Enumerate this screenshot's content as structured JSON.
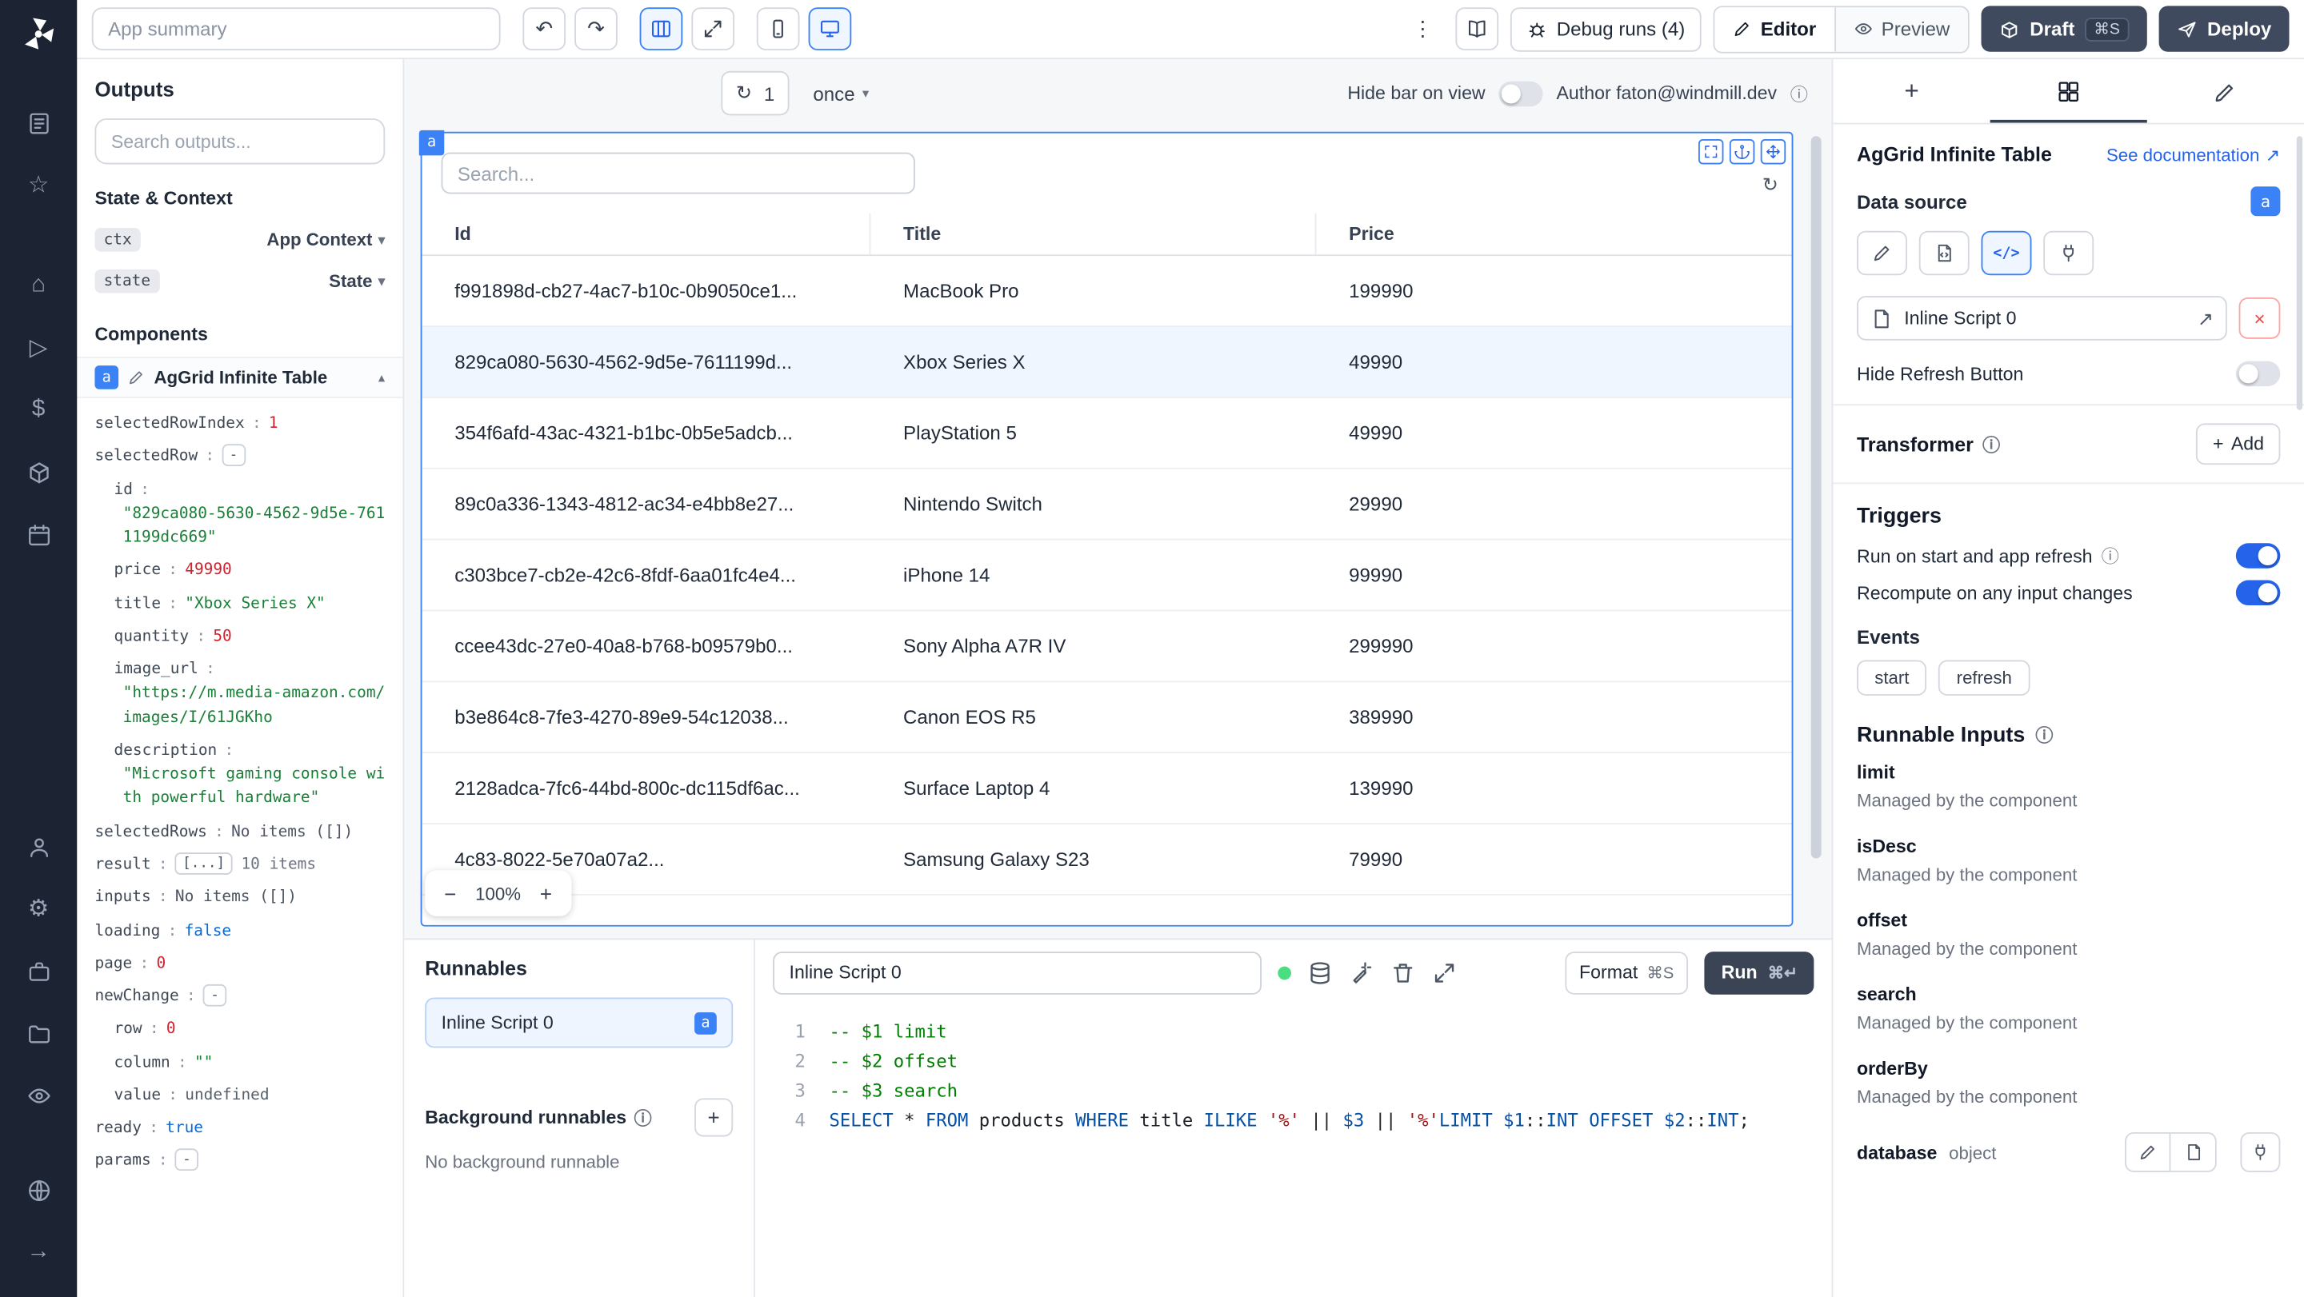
{
  "icons": {
    "undo": "↶",
    "redo": "↷",
    "dots_vertical": "⋮",
    "refresh": "↻",
    "minus": "−",
    "plus": "+",
    "close": "×",
    "external_link": "↗",
    "chevron_down": "▾",
    "chevron_up": "▴",
    "star": "☆",
    "home": "⌂",
    "play": "▷",
    "dollar": "$",
    "gear": "⚙",
    "arrow_right": "→",
    "info": "ⓘ",
    "code": "</>"
  },
  "topbar": {
    "app_summary_placeholder": "App summary",
    "debug_runs_label": "Debug runs (4)",
    "editor_label": "Editor",
    "preview_label": "Preview",
    "draft_label": "Draft",
    "draft_shortcut": "⌘S",
    "deploy_label": "Deploy"
  },
  "outputs": {
    "title": "Outputs",
    "search_placeholder": "Search outputs...",
    "state_context_title": "State & Context",
    "ctx_badge": "ctx",
    "ctx_label": "App Context",
    "state_badge": "state",
    "state_label": "State",
    "components_title": "Components",
    "component_badge": "a",
    "component_title": "AgGrid Infinite Table",
    "tree": [
      {
        "key": "selectedRowIndex",
        "value": "1"
      },
      {
        "key": "selectedRow",
        "value": "-"
      },
      {
        "key": "id",
        "value": "\"829ca080-5630-4562-9d5e-7611199dc669\""
      },
      {
        "key": "price",
        "value": "49990"
      },
      {
        "key": "title",
        "value": "\"Xbox Series X\""
      },
      {
        "key": "quantity",
        "value": "50"
      },
      {
        "key": "image_url",
        "value": "\"https://m.media-amazon.com/images/I/61JGKho"
      },
      {
        "key": "description",
        "value": "\"Microsoft gaming console with powerful hardware\""
      },
      {
        "key": "selectedRows",
        "value": "No items ([])"
      },
      {
        "key": "result",
        "value": "[...]",
        "suffix": "10 items"
      },
      {
        "key": "inputs",
        "value": "No items ([])"
      },
      {
        "key": "loading",
        "value": "false"
      },
      {
        "key": "page",
        "value": "0"
      },
      {
        "key": "newChange",
        "value": "-"
      },
      {
        "key": "row",
        "value": "0"
      },
      {
        "key": "column",
        "value": "\"\""
      },
      {
        "key": "value",
        "value": "undefined"
      },
      {
        "key": "ready",
        "value": "true"
      },
      {
        "key": "params",
        "value": "-"
      }
    ]
  },
  "canvas": {
    "refresh_count": "1",
    "interval_label": "once",
    "hide_bar_label": "Hide bar on view",
    "author_label": "Author faton@windmill.dev",
    "component_badge": "a",
    "search_placeholder": "Search...",
    "zoom_value": "100%",
    "table": {
      "columns": [
        "Id",
        "Title",
        "Price"
      ],
      "rows": [
        {
          "id": "f991898d-cb27-4ac7-b10c-0b9050ce1...",
          "title": "MacBook Pro",
          "price": "199990"
        },
        {
          "id": "829ca080-5630-4562-9d5e-7611199d...",
          "title": "Xbox Series X",
          "price": "49990"
        },
        {
          "id": "354f6afd-43ac-4321-b1bc-0b5e5adcb...",
          "title": "PlayStation 5",
          "price": "49990"
        },
        {
          "id": "89c0a336-1343-4812-ac34-e4bb8e27...",
          "title": "Nintendo Switch",
          "price": "29990"
        },
        {
          "id": "c303bce7-cb2e-42c6-8fdf-6aa01fc4e4...",
          "title": "iPhone 14",
          "price": "99990"
        },
        {
          "id": "ccee43dc-27e0-40a8-b768-b09579b0...",
          "title": "Sony Alpha A7R IV",
          "price": "299990"
        },
        {
          "id": "b3e864c8-7fe3-4270-89e9-54c12038...",
          "title": "Canon EOS R5",
          "price": "389990"
        },
        {
          "id": "2128adca-7fc6-44bd-800c-dc115df6ac...",
          "title": "Surface Laptop 4",
          "price": "139990"
        },
        {
          "id": "4c83-8022-5e70a07a2...",
          "title": "Samsung Galaxy S23",
          "price": "79990"
        }
      ]
    }
  },
  "runnables": {
    "title": "Runnables",
    "item_label": "Inline Script 0",
    "item_badge": "a",
    "background_title": "Background runnables",
    "background_empty": "No background runnable"
  },
  "script_editor": {
    "name_value": "Inline Script 0",
    "format_label": "Format",
    "format_shortcut": "⌘S",
    "run_label": "Run",
    "run_shortcut": "⌘↵",
    "lines": [
      {
        "num": "1",
        "tokens": [
          {
            "c": "comment",
            "t": "-- $1 limit"
          }
        ]
      },
      {
        "num": "2",
        "tokens": [
          {
            "c": "comment",
            "t": "-- $2 offset"
          }
        ]
      },
      {
        "num": "3",
        "tokens": [
          {
            "c": "comment",
            "t": "-- $3 search"
          }
        ]
      },
      {
        "num": "4",
        "tokens": [
          {
            "c": "kw",
            "t": "SELECT"
          },
          {
            "c": "pl",
            "t": " * "
          },
          {
            "c": "kw",
            "t": "FROM"
          },
          {
            "c": "pl",
            "t": " products "
          },
          {
            "c": "kw",
            "t": "WHERE"
          },
          {
            "c": "pl",
            "t": " title "
          },
          {
            "c": "kw",
            "t": "ILIKE"
          },
          {
            "c": "pl",
            "t": " "
          },
          {
            "c": "str",
            "t": "'%'"
          },
          {
            "c": "pl",
            "t": " || "
          },
          {
            "c": "var",
            "t": "$3"
          },
          {
            "c": "pl",
            "t": " || "
          },
          {
            "c": "str",
            "t": "'%'"
          },
          {
            "c": "kw",
            "t": "LIMIT"
          },
          {
            "c": "pl",
            "t": " "
          },
          {
            "c": "var",
            "t": "$1"
          },
          {
            "c": "pl",
            "t": "::"
          },
          {
            "c": "kw",
            "t": "INT"
          },
          {
            "c": "pl",
            "t": " "
          },
          {
            "c": "kw",
            "t": "OFFSET"
          },
          {
            "c": "pl",
            "t": " "
          },
          {
            "c": "var",
            "t": "$2"
          },
          {
            "c": "pl",
            "t": "::"
          },
          {
            "c": "kw",
            "t": "INT"
          },
          {
            "c": "pl",
            "t": ";"
          }
        ]
      }
    ]
  },
  "inspector": {
    "component_title": "AgGrid Infinite Table",
    "doc_link": "See documentation",
    "data_source_label": "Data source",
    "data_source_badge": "a",
    "script_name": "Inline Script 0",
    "hide_refresh_label": "Hide Refresh Button",
    "transformer_label": "Transformer",
    "add_label": "Add",
    "triggers_title": "Triggers",
    "run_on_start_label": "Run on start and app refresh",
    "recompute_label": "Recompute on any input changes",
    "events_label": "Events",
    "events": [
      "start",
      "refresh"
    ],
    "runnable_inputs_title": "Runnable Inputs",
    "managed_text": "Managed by the component",
    "inputs": [
      "limit",
      "isDesc",
      "offset",
      "search",
      "orderBy"
    ],
    "database_label": "database",
    "database_type": "object"
  }
}
